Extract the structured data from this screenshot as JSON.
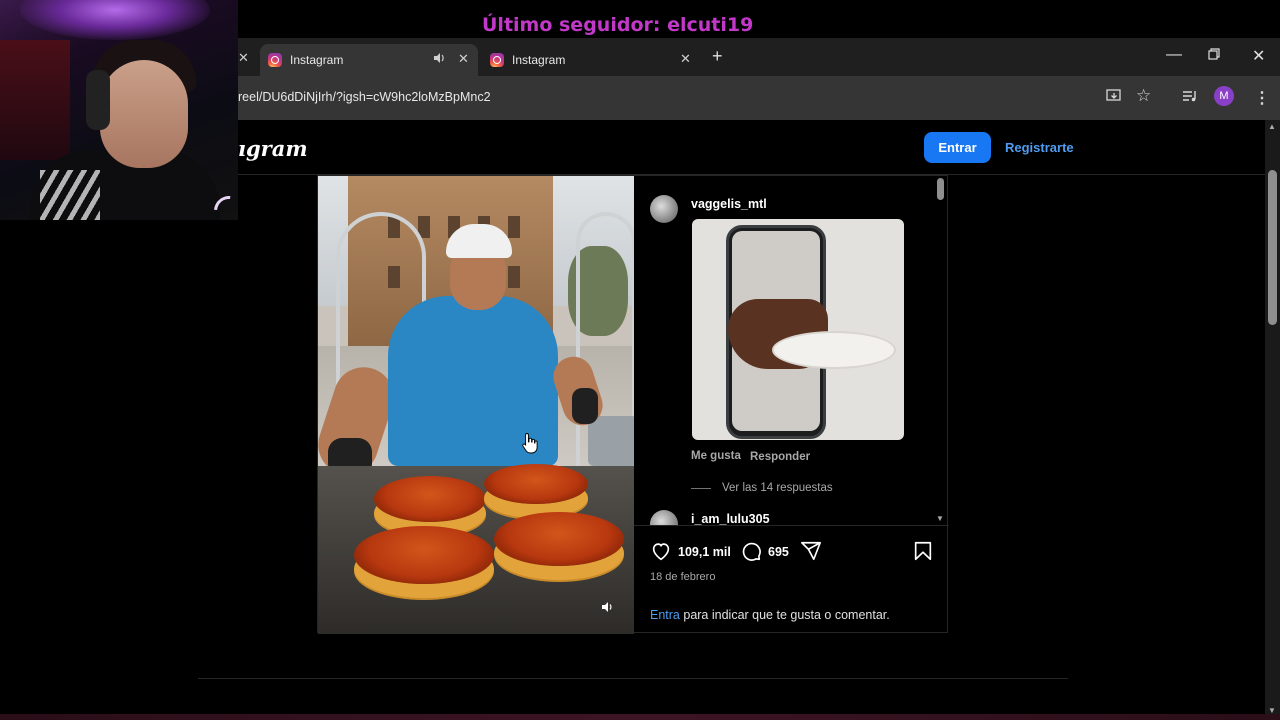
{
  "overlay": {
    "follower_text": "Último seguidor: elcuti19"
  },
  "browser": {
    "tabs": [
      {
        "label": "Instagram",
        "active": true,
        "audio": true
      },
      {
        "label": "Instagram",
        "active": false,
        "audio": false
      }
    ],
    "url": "reel/DU6dDiNjIrh/?igsh=cW9hc2loMzBpMnc2",
    "profile_initial": "M"
  },
  "header": {
    "logo_text": "ıgram",
    "login_label": "Entrar",
    "signup_label": "Registrarte"
  },
  "comments": [
    {
      "user": "vaggelis_mtl",
      "has_gif": true,
      "like_label": "Me gusta",
      "reply_label": "Responder",
      "replies_label": "Ver las 14 respuestas"
    },
    {
      "user": "i_am_lulu305"
    }
  ],
  "post": {
    "likes": "109,1 mil",
    "comments_count": "695",
    "date": "18 de febrero",
    "login_link": "Entra",
    "login_hint": " para indicar que te gusta o comentar."
  },
  "colors": {
    "accent_blue": "#1877f2",
    "link_blue": "#4f9cf0",
    "follower_purple": "#c238c9"
  }
}
